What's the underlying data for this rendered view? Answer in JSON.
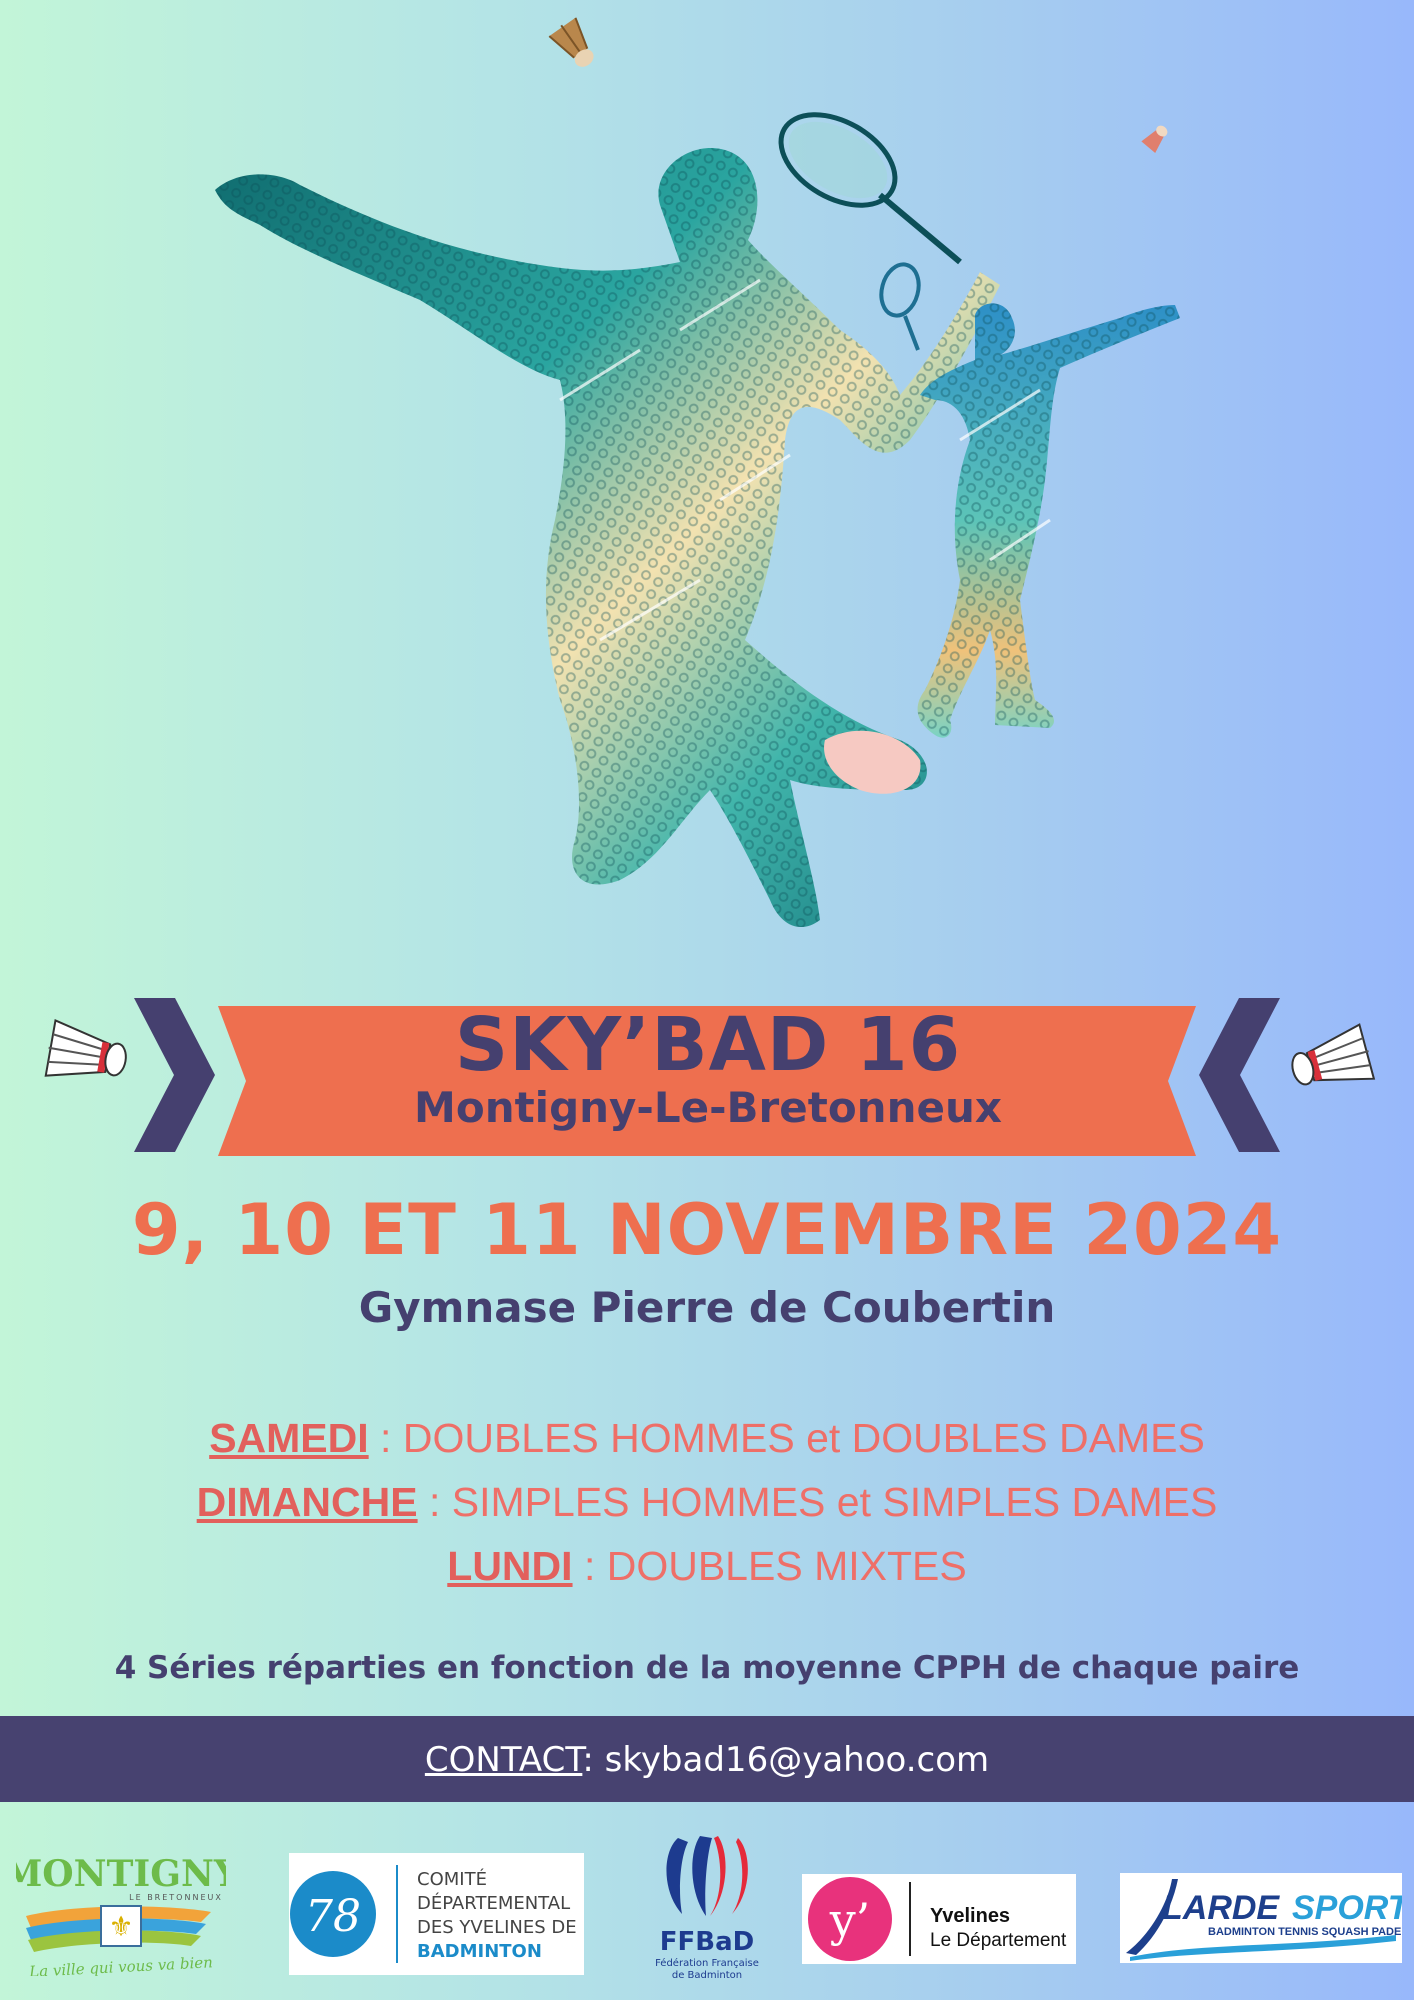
{
  "event": {
    "title": "SKY’BAD 16",
    "city": "Montigny-Le-Bretonneux",
    "dates": "9, 10 ET 11 NOVEMBRE 2024",
    "venue": "Gymnase Pierre de Coubertin"
  },
  "schedule": [
    {
      "day": "SAMEDI",
      "events": " : DOUBLES HOMMES et DOUBLES DAMES"
    },
    {
      "day": "DIMANCHE",
      "events": " :  SIMPLES HOMMES et SIMPLES DAMES"
    },
    {
      "day": "LUNDI",
      "events": " : DOUBLES MIXTES"
    }
  ],
  "series_note": "4 Séries réparties en fonction de la moyenne CPPH de chaque paire",
  "contact": {
    "label": "CONTACT",
    "email": ": skybad16@yahoo.com"
  },
  "logos": {
    "montigny": {
      "name": "MONTIGNY",
      "sub": "LE BRETONNEUX",
      "slogan": "La ville qui vous va bien"
    },
    "comite": {
      "number": "78",
      "line1": "COMITÉ",
      "line2": "DÉPARTEMENTAL",
      "line3": "DES YVELINES DE",
      "line4": "BADMINTON"
    },
    "ffbad": {
      "name": "FFBaD",
      "sub1": "Fédération Française",
      "sub2": "de Badminton"
    },
    "yvelines": {
      "mark": "y’",
      "name": "Yvelines",
      "sub": "Le Département"
    },
    "larde": {
      "name1": "LARDE",
      "name2": "SPORTS",
      "sub": "BADMINTON TENNIS SQUASH PADEL"
    }
  },
  "colors": {
    "accent": "#ee6f4f",
    "navy": "#45406f",
    "banner": "#ee6f4f",
    "contact_bar": "#474270"
  },
  "icons": [
    "shuttlecock-icon",
    "chevron-left-icon",
    "chevron-right-icon"
  ]
}
